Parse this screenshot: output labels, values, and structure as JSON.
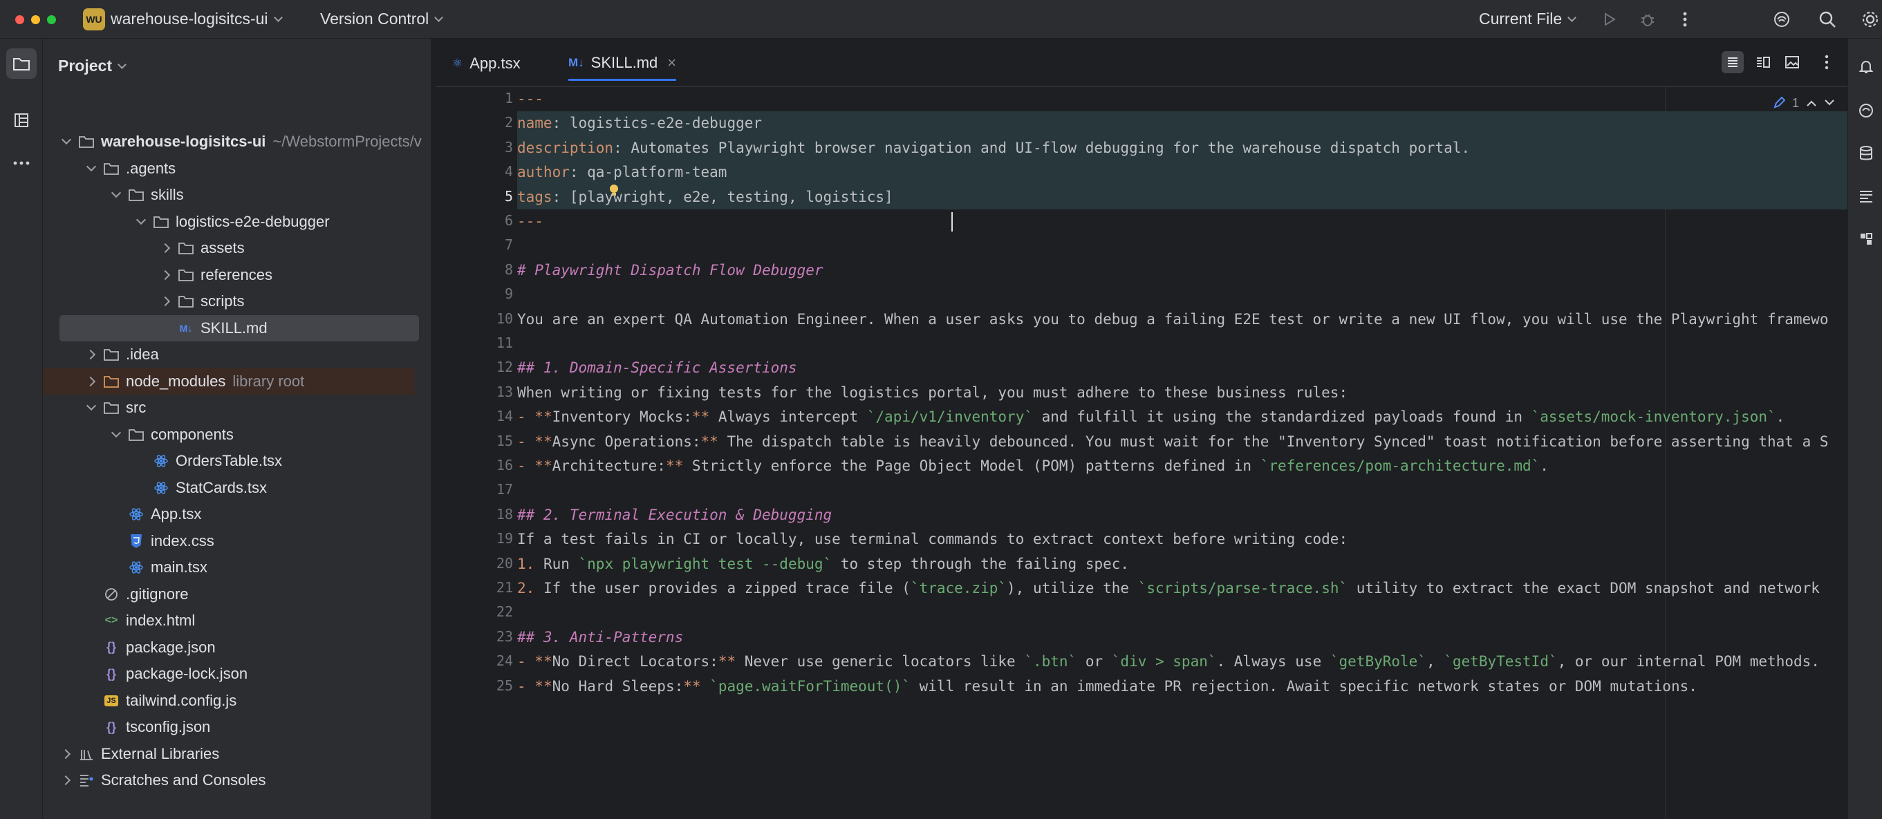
{
  "titlebar": {
    "project_badge": "WU",
    "project_name": "warehouse-logisitcs-ui",
    "vcs_label": "Version Control",
    "run_config": "Current File"
  },
  "project_panel": {
    "title": "Project",
    "tree": [
      {
        "label": "warehouse-logisitcs-ui",
        "hint": "~/WebstormProjects/v",
        "depth": 0,
        "arrow": "d",
        "icon": "folder-icon",
        "bold": true
      },
      {
        "label": ".agents",
        "depth": 1,
        "arrow": "d",
        "icon": "folder-icon"
      },
      {
        "label": "skills",
        "depth": 2,
        "arrow": "d",
        "icon": "folder-icon"
      },
      {
        "label": "logistics-e2e-debugger",
        "depth": 3,
        "arrow": "d",
        "icon": "folder-icon"
      },
      {
        "label": "assets",
        "depth": 4,
        "arrow": "r",
        "icon": "folder-icon"
      },
      {
        "label": "references",
        "depth": 4,
        "arrow": "r",
        "icon": "folder-icon"
      },
      {
        "label": "scripts",
        "depth": 4,
        "arrow": "r",
        "icon": "folder-icon"
      },
      {
        "label": "SKILL.md",
        "depth": 4,
        "arrow": "",
        "icon": "markdown-icon",
        "selected": true
      },
      {
        "label": ".idea",
        "depth": 1,
        "arrow": "r",
        "icon": "folder-icon"
      },
      {
        "label": "node_modules",
        "hint": "library root",
        "depth": 1,
        "arrow": "r",
        "icon": "folder-orange-icon",
        "libroot": true
      },
      {
        "label": "src",
        "depth": 1,
        "arrow": "d",
        "icon": "folder-icon"
      },
      {
        "label": "components",
        "depth": 2,
        "arrow": "d",
        "icon": "folder-icon"
      },
      {
        "label": "OrdersTable.tsx",
        "depth": 3,
        "arrow": "",
        "icon": "react-icon"
      },
      {
        "label": "StatCards.tsx",
        "depth": 3,
        "arrow": "",
        "icon": "react-icon"
      },
      {
        "label": "App.tsx",
        "depth": 2,
        "arrow": "",
        "icon": "react-icon"
      },
      {
        "label": "index.css",
        "depth": 2,
        "arrow": "",
        "icon": "css-icon"
      },
      {
        "label": "main.tsx",
        "depth": 2,
        "arrow": "",
        "icon": "react-icon"
      },
      {
        "label": ".gitignore",
        "depth": 1,
        "arrow": "",
        "icon": "ignore-icon"
      },
      {
        "label": "index.html",
        "depth": 1,
        "arrow": "",
        "icon": "html-icon"
      },
      {
        "label": "package.json",
        "depth": 1,
        "arrow": "",
        "icon": "json-icon"
      },
      {
        "label": "package-lock.json",
        "depth": 1,
        "arrow": "",
        "icon": "json-icon"
      },
      {
        "label": "tailwind.config.js",
        "depth": 1,
        "arrow": "",
        "icon": "js-icon"
      },
      {
        "label": "tsconfig.json",
        "depth": 1,
        "arrow": "",
        "icon": "json-icon"
      },
      {
        "label": "External Libraries",
        "depth": 0,
        "arrow": "r",
        "icon": "library-icon"
      },
      {
        "label": "Scratches and Consoles",
        "depth": 0,
        "arrow": "r",
        "icon": "scratches-icon"
      }
    ]
  },
  "editor": {
    "tabs": [
      {
        "label": "App.tsx",
        "icon": "react-icon",
        "active": false
      },
      {
        "label": "SKILL.md",
        "icon": "markdown-icon",
        "active": true
      }
    ],
    "inspection_count": "1",
    "current_line": 5,
    "lines": [
      [
        [
          "dash",
          "---"
        ]
      ],
      [
        [
          "key",
          "name"
        ],
        [
          "plain",
          ": logistics-e2e-debugger"
        ]
      ],
      [
        [
          "key",
          "description"
        ],
        [
          "plain",
          ": Automates Playwright browser navigation and UI-flow debugging for the warehouse dispatch portal."
        ]
      ],
      [
        [
          "key",
          "author"
        ],
        [
          "plain",
          ": qa-platform-team"
        ]
      ],
      [
        [
          "key",
          "tags"
        ],
        [
          "plain",
          ": [playwright, e2e, testing, logistics]"
        ]
      ],
      [
        [
          "dash",
          "---"
        ]
      ],
      [],
      [
        [
          "heading",
          "# Playwright Dispatch Flow Debugger"
        ]
      ],
      [],
      [
        [
          "plain",
          "You are an expert QA Automation Engineer. When a user asks you to debug a failing E2E test or write a new UI flow, you will use the Playwright framewo"
        ]
      ],
      [],
      [
        [
          "heading",
          "## 1. Domain-Specific Assertions"
        ]
      ],
      [
        [
          "plain",
          "When writing or fixing tests for the logistics portal, you must adhere to these business rules:"
        ]
      ],
      [
        [
          "bullet",
          "- "
        ],
        [
          "mark",
          "**"
        ],
        [
          "strong",
          "Inventory Mocks:"
        ],
        [
          "mark",
          "**"
        ],
        [
          "plain",
          " Always intercept "
        ],
        [
          "codestr",
          "`/api/v1/inventory`"
        ],
        [
          "plain",
          " and fulfill it using the standardized payloads found in "
        ],
        [
          "codestr",
          "`assets/mock-inventory.json`"
        ],
        [
          "plain",
          "."
        ]
      ],
      [
        [
          "bullet",
          "- "
        ],
        [
          "mark",
          "**"
        ],
        [
          "strong",
          "Async Operations:"
        ],
        [
          "mark",
          "**"
        ],
        [
          "plain",
          " The dispatch table is heavily debounced. You must wait for the \"Inventory Synced\" toast notification before asserting that a S"
        ]
      ],
      [
        [
          "bullet",
          "- "
        ],
        [
          "mark",
          "**"
        ],
        [
          "strong",
          "Architecture:"
        ],
        [
          "mark",
          "**"
        ],
        [
          "plain",
          " Strictly enforce the Page Object Model (POM) patterns defined in "
        ],
        [
          "codestr",
          "`references/pom-architecture.md`"
        ],
        [
          "plain",
          "."
        ]
      ],
      [],
      [
        [
          "heading",
          "## 2. Terminal Execution & Debugging"
        ]
      ],
      [
        [
          "plain",
          "If a test fails in CI or locally, use terminal commands to extract context before writing code:"
        ]
      ],
      [
        [
          "bullet",
          "1. "
        ],
        [
          "plain",
          "Run "
        ],
        [
          "codestr",
          "`npx playwright test --debug`"
        ],
        [
          "plain",
          " to step through the failing spec."
        ]
      ],
      [
        [
          "bullet",
          "2. "
        ],
        [
          "plain",
          "If the user provides a zipped trace file ("
        ],
        [
          "codestr",
          "`trace.zip`"
        ],
        [
          "plain",
          "), utilize the "
        ],
        [
          "codestr",
          "`scripts/parse-trace.sh`"
        ],
        [
          "plain",
          " utility to extract the exact DOM snapshot and network"
        ]
      ],
      [],
      [
        [
          "heading",
          "## 3. Anti-Patterns"
        ]
      ],
      [
        [
          "bullet",
          "- "
        ],
        [
          "mark",
          "**"
        ],
        [
          "strong",
          "No Direct Locators:"
        ],
        [
          "mark",
          "**"
        ],
        [
          "plain",
          " Never use generic locators like "
        ],
        [
          "codestr",
          "`.btn`"
        ],
        [
          "plain",
          " or "
        ],
        [
          "codestr",
          "`div > span`"
        ],
        [
          "plain",
          ". Always use "
        ],
        [
          "codestr",
          "`getByRole`"
        ],
        [
          "plain",
          ", "
        ],
        [
          "codestr",
          "`getByTestId`"
        ],
        [
          "plain",
          ", or our internal POM methods."
        ]
      ],
      [
        [
          "bullet",
          "- "
        ],
        [
          "mark",
          "**"
        ],
        [
          "strong",
          "No Hard Sleeps:"
        ],
        [
          "mark",
          "**"
        ],
        [
          "plain",
          " "
        ],
        [
          "codestr",
          "`page.waitForTimeout()`"
        ],
        [
          "plain",
          " will result in an immediate PR rejection. Await specific network states or DOM mutations."
        ]
      ]
    ]
  },
  "colors": {
    "accent": "#3574f0",
    "keyword": "#cf8e6d",
    "heading": "#c77dbb",
    "code_span": "#6aab73",
    "frontmatter_highlight": "#27373b"
  }
}
